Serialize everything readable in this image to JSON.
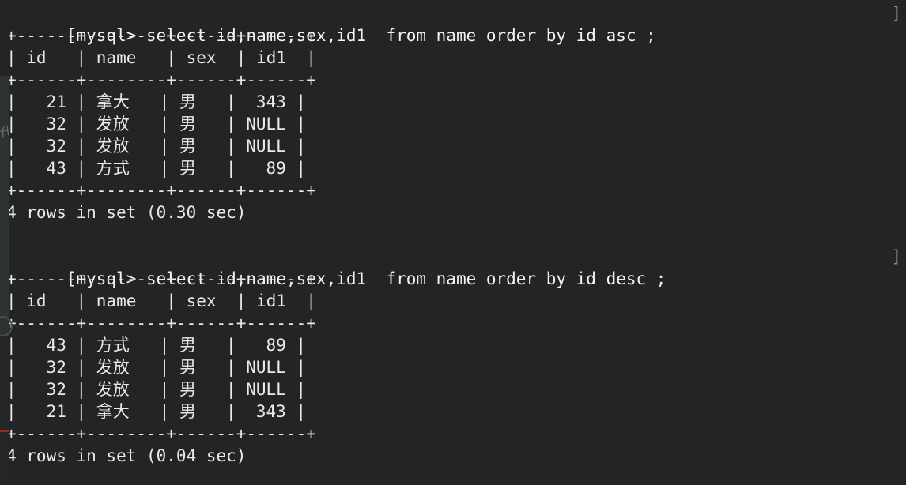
{
  "terminal": {
    "background_color": "#222426",
    "foreground_color": "#e8e9ea",
    "marker_color": "#8b8f90",
    "edge_marker": "]"
  },
  "gutter": {
    "name": "editor-gutter",
    "red_marker_color": "#9e2b22",
    "ghost_text": "代码"
  },
  "session": {
    "queries": [
      {
        "prompt": "[mysql> ",
        "command": "select id,name,sex,id1  from name order by id asc ;",
        "full_line": "[mysql> select id,name,sex,id1  from name order by id asc ;",
        "separator": "+------+--------+------+------+",
        "header_row": "| id   | name   | sex  | id1  |",
        "columns": [
          "id",
          "name",
          "sex",
          "id1"
        ],
        "rows": [
          "|   21 | 拿大   | 男   |  343 |",
          "|   32 | 发放   | 男   | NULL |",
          "|   32 | 发放   | 男   | NULL |",
          "|   43 | 方式   | 男   |   89 |"
        ],
        "row_values": [
          {
            "id": "21",
            "name": "拿大",
            "sex": "男",
            "id1": "343"
          },
          {
            "id": "32",
            "name": "发放",
            "sex": "男",
            "id1": "NULL"
          },
          {
            "id": "32",
            "name": "发放",
            "sex": "男",
            "id1": "NULL"
          },
          {
            "id": "43",
            "name": "方式",
            "sex": "男",
            "id1": "89"
          }
        ],
        "status": "4 rows in set (0.30 sec)",
        "row_count": 4,
        "elapsed": "0.30 sec"
      },
      {
        "prompt": "[mysql> ",
        "command": "select id,name,sex,id1  from name order by id desc ;",
        "full_line": "[mysql> select id,name,sex,id1  from name order by id desc ;",
        "separator": "+------+--------+------+------+",
        "header_row": "| id   | name   | sex  | id1  |",
        "columns": [
          "id",
          "name",
          "sex",
          "id1"
        ],
        "rows": [
          "|   43 | 方式   | 男   |   89 |",
          "|   32 | 发放   | 男   | NULL |",
          "|   32 | 发放   | 男   | NULL |",
          "|   21 | 拿大   | 男   |  343 |"
        ],
        "row_values": [
          {
            "id": "43",
            "name": "方式",
            "sex": "男",
            "id1": "89"
          },
          {
            "id": "32",
            "name": "发放",
            "sex": "男",
            "id1": "NULL"
          },
          {
            "id": "32",
            "name": "发放",
            "sex": "男",
            "id1": "NULL"
          },
          {
            "id": "21",
            "name": "拿大",
            "sex": "男",
            "id1": "343"
          }
        ],
        "status": "4 rows in set (0.04 sec)",
        "row_count": 4,
        "elapsed": "0.04 sec"
      }
    ]
  }
}
